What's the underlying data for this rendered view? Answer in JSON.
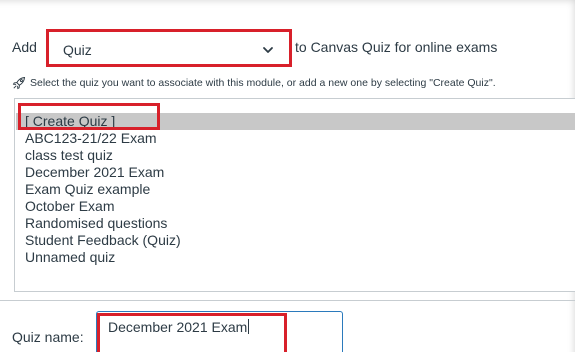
{
  "add_row": {
    "label": "Add",
    "select_value": "Quiz",
    "chevron_icon": "chevron-down-icon",
    "suffix": "to Canvas Quiz for online exams"
  },
  "hint": {
    "icon": "rocket-icon",
    "text": "Select the quiz you want to associate with this module, or add a new one by selecting \"Create Quiz\"."
  },
  "quiz_list": {
    "options": [
      "[ Create Quiz ]",
      "ABC123-21/22 Exam",
      "class test quiz",
      "December 2021 Exam",
      "Exam Quiz example",
      "October Exam",
      "Randomised questions",
      "Student Feedback (Quiz)",
      "Unnamed quiz"
    ],
    "selected_index": 0
  },
  "quiz_name": {
    "label": "Quiz name:",
    "value": "December 2021 Exam"
  },
  "colors": {
    "highlight_red": "#d8202a",
    "selected_row": "#c8c8c8",
    "text": "#2d3b45",
    "focus_border": "#2b7abc"
  }
}
